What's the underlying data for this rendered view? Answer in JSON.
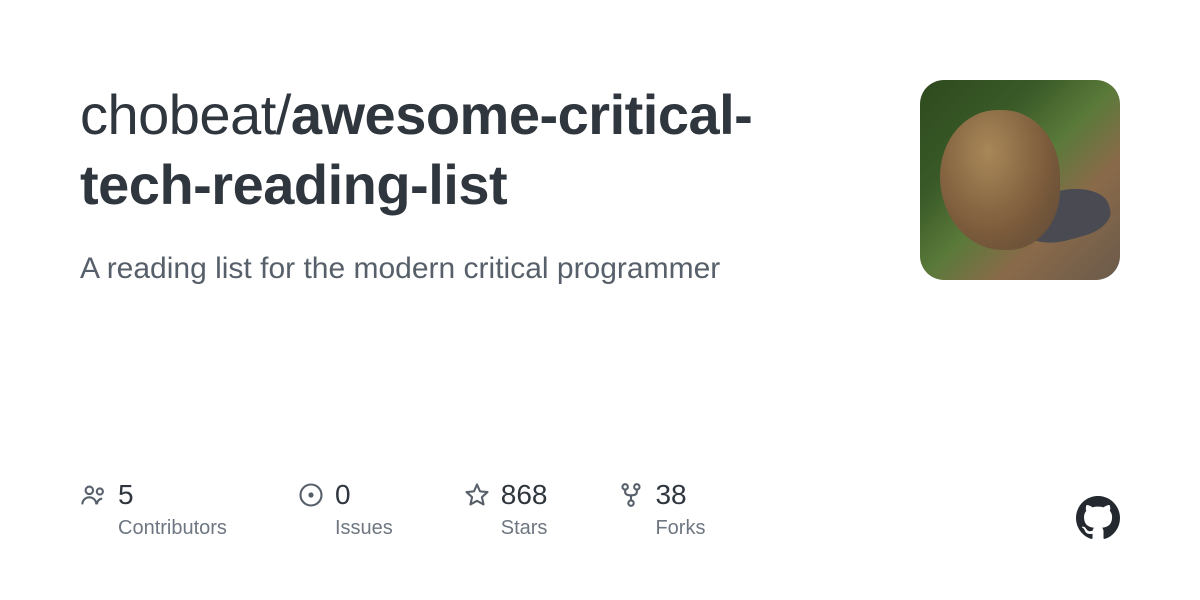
{
  "repo": {
    "owner": "chobeat",
    "separator": "/",
    "name": "awesome-critical-tech-reading-list",
    "description": "A reading list for the modern critical programmer"
  },
  "stats": {
    "contributors": {
      "value": "5",
      "label": "Contributors"
    },
    "issues": {
      "value": "0",
      "label": "Issues"
    },
    "stars": {
      "value": "868",
      "label": "Stars"
    },
    "forks": {
      "value": "38",
      "label": "Forks"
    }
  }
}
